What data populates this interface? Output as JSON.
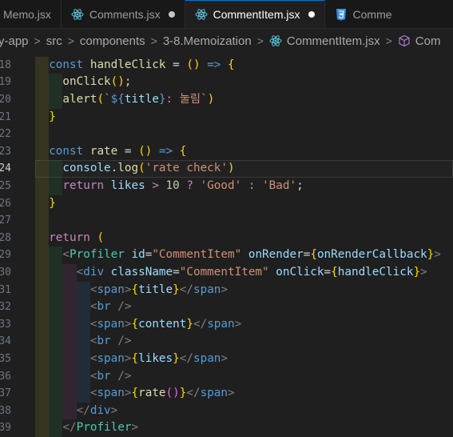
{
  "tabs": [
    {
      "label": "Memo.jsx",
      "icon": "react-icon",
      "active": false,
      "modified": false
    },
    {
      "label": "Comments.jsx",
      "icon": "react-icon",
      "active": false,
      "modified": true
    },
    {
      "label": "CommentItem.jsx",
      "icon": "react-icon",
      "active": true,
      "modified": true
    },
    {
      "label": "Comme",
      "icon": "css-icon",
      "active": false,
      "modified": false
    }
  ],
  "breadcrumb": {
    "items": [
      "y-app",
      "src",
      "components",
      "3-8.Memoization",
      "CommentItem.jsx",
      "Com"
    ]
  },
  "editor": {
    "current_line": "24",
    "line_numbers": [
      "18",
      "19",
      "20",
      "21",
      "22",
      "23",
      "24",
      "25",
      "26",
      "27",
      "28",
      "29",
      "30",
      "31",
      "32",
      "33",
      "34",
      "35",
      "36",
      "37",
      "38",
      "39"
    ],
    "lines": [
      "  const handleClick = () => {",
      "    onClick();",
      "    alert(`${title}: 눌림`)",
      "  }",
      "",
      "  const rate = () => {",
      "    console.log('rate check')",
      "    return likes > 10 ? 'Good' : 'Bad';",
      "  }",
      "",
      "  return (",
      "    <Profiler id=\"CommentItem\" onRender={onRenderCallback}>",
      "      <div className=\"CommentItem\" onClick={handleClick}>",
      "        <span>{title}</span>",
      "        <br />",
      "        <span>{content}</span>",
      "        <br />",
      "        <span>{likes}</span>",
      "        <br />",
      "        <span>{rate()}</span>",
      "      </div>",
      "    </Profiler>"
    ]
  },
  "colors": {
    "background": "#1f1f1f",
    "keyword": "#c586c0",
    "const": "#569cd6",
    "function": "#dcdcaa",
    "variable": "#9cdcfe",
    "string": "#ce9178",
    "number": "#b5cea8",
    "component": "#4ec9b0"
  }
}
